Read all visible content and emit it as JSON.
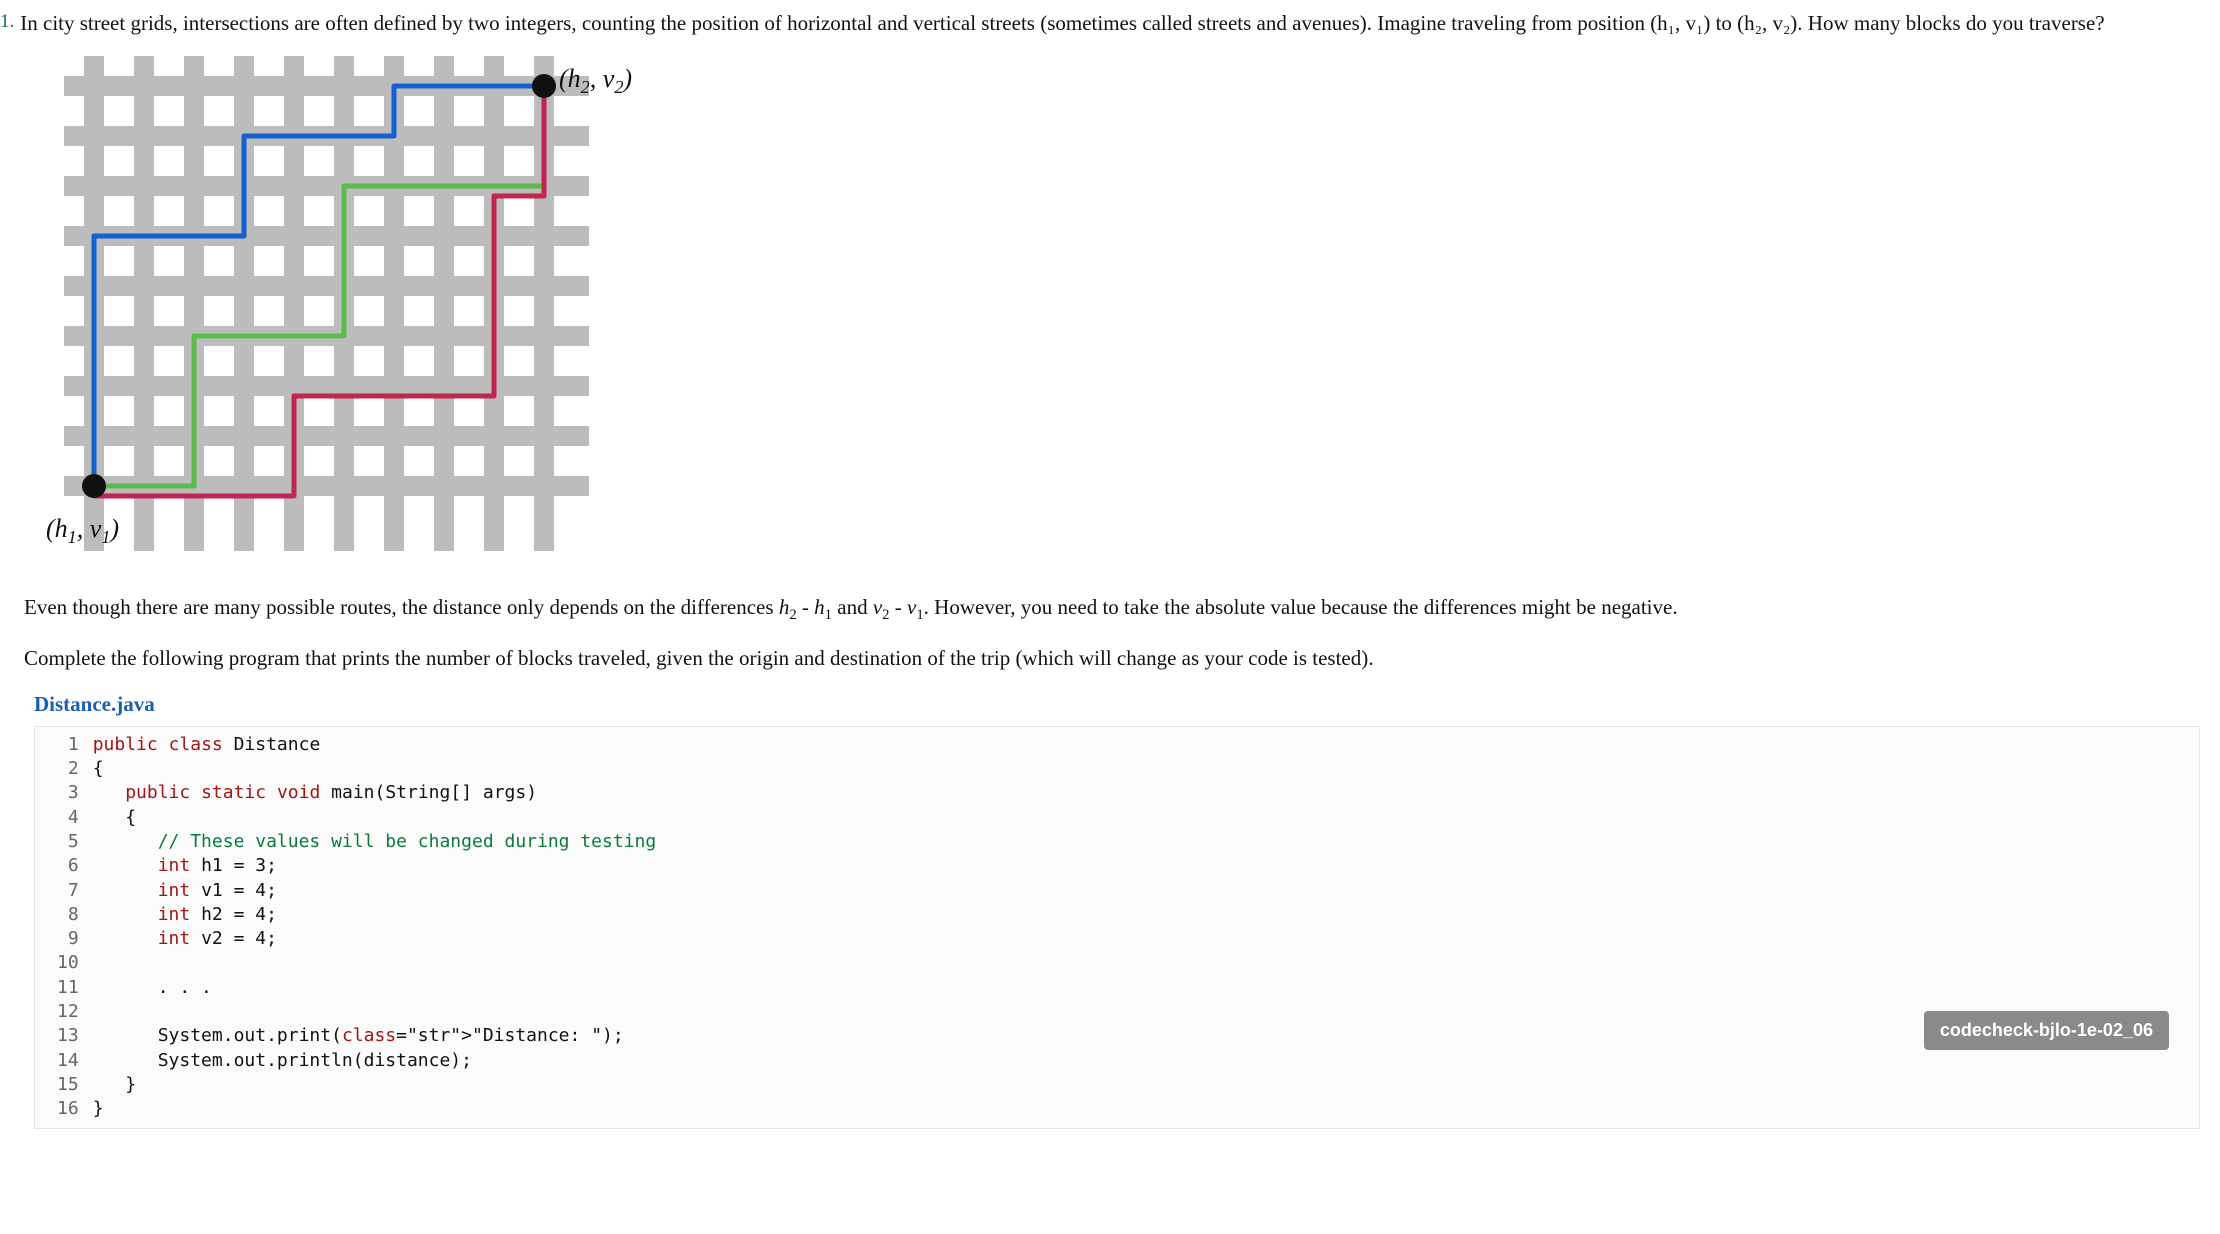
{
  "question": {
    "number": "1.",
    "text": "In city street grids, intersections are often defined by two integers, counting the position of horizontal and vertical streets (sometimes called streets and avenues). Imagine traveling from position (h₁, v₁) to (h₂, v₂). How many blocks do you traverse?"
  },
  "figure": {
    "label_start": "(h₁, v₁)",
    "label_end": "(h₂, v₂)"
  },
  "para1": "Even though there are many possible routes, the distance only depends on the differences h₂ - h₁ and v₂ - v₁. However, you need to take the absolute value because the differences might be negative.",
  "para2": "Complete the following program that prints the number of blocks traveled, given the origin and destination of the trip (which will change as your code is tested).",
  "filename": "Distance.java",
  "code": {
    "lines": [
      "public class Distance",
      "{",
      "   public static void main(String[] args)",
      "   {",
      "      // These values will be changed during testing",
      "      int h1 = 3;",
      "      int v1 = 4;",
      "      int h2 = 4;",
      "      int v2 = 4;",
      "",
      "      . . .",
      "",
      "      System.out.print(\"Distance: \");",
      "      System.out.println(distance);",
      "   }",
      "}"
    ]
  },
  "badge": "codecheck-bjlo-1e-02_06"
}
